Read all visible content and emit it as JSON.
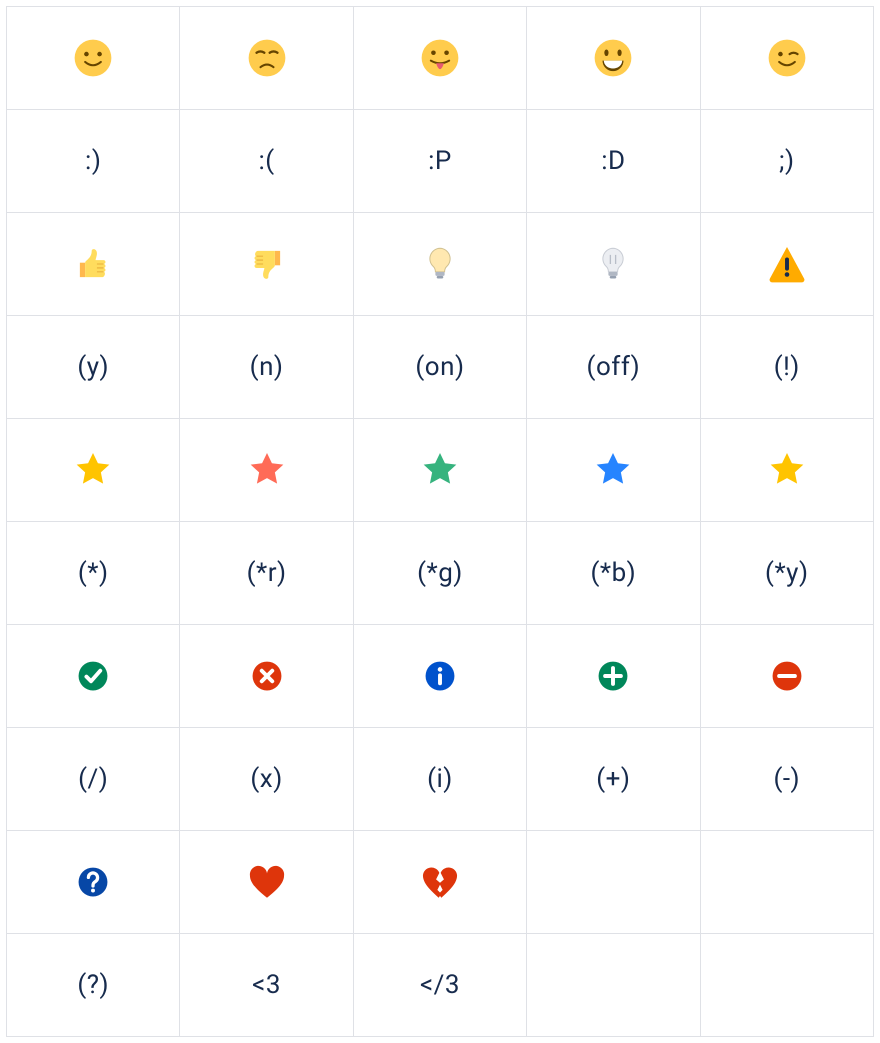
{
  "rows": [
    {
      "icons": [
        {
          "name": "smile-icon",
          "kind": "svg",
          "svg": "smile"
        },
        {
          "name": "frown-icon",
          "kind": "svg",
          "svg": "frown"
        },
        {
          "name": "tongue-icon",
          "kind": "svg",
          "svg": "tongue"
        },
        {
          "name": "grin-icon",
          "kind": "svg",
          "svg": "grin"
        },
        {
          "name": "wink-icon",
          "kind": "svg",
          "svg": "wink"
        }
      ],
      "codes": [
        ":)",
        ":(",
        ":P",
        ":D",
        ";)"
      ]
    },
    {
      "icons": [
        {
          "name": "thumbs-up-icon",
          "kind": "svg",
          "svg": "thumbsup"
        },
        {
          "name": "thumbs-down-icon",
          "kind": "svg",
          "svg": "thumbsdown"
        },
        {
          "name": "bulb-on-icon",
          "kind": "svg",
          "svg": "bulb-on"
        },
        {
          "name": "bulb-off-icon",
          "kind": "svg",
          "svg": "bulb-off"
        },
        {
          "name": "warning-icon",
          "kind": "svg",
          "svg": "warning"
        }
      ],
      "codes": [
        "(y)",
        "(n)",
        "(on)",
        "(off)",
        "(!)"
      ]
    },
    {
      "icons": [
        {
          "name": "star-yellow-icon",
          "kind": "svg",
          "svg": "star",
          "color": "#FFC400"
        },
        {
          "name": "star-red-icon",
          "kind": "svg",
          "svg": "star",
          "color": "#FF6B57"
        },
        {
          "name": "star-green-icon",
          "kind": "svg",
          "svg": "star",
          "color": "#36B37E"
        },
        {
          "name": "star-blue-icon",
          "kind": "svg",
          "svg": "star",
          "color": "#2684FF"
        },
        {
          "name": "star-yellow2-icon",
          "kind": "svg",
          "svg": "star",
          "color": "#FFC400"
        }
      ],
      "codes": [
        "(*)",
        "(*r)",
        "(*g)",
        "(*b)",
        "(*y)"
      ]
    },
    {
      "icons": [
        {
          "name": "check-circle-icon",
          "kind": "svg",
          "svg": "circle-check",
          "color": "#00875A"
        },
        {
          "name": "cross-circle-icon",
          "kind": "svg",
          "svg": "circle-cross",
          "color": "#DE350B"
        },
        {
          "name": "info-circle-icon",
          "kind": "svg",
          "svg": "circle-info",
          "color": "#0052CC"
        },
        {
          "name": "plus-circle-icon",
          "kind": "svg",
          "svg": "circle-plus",
          "color": "#00875A"
        },
        {
          "name": "minus-circle-icon",
          "kind": "svg",
          "svg": "circle-minus",
          "color": "#DE350B"
        }
      ],
      "codes": [
        "(/)",
        "(x)",
        "(i)",
        "(+)",
        "(-)"
      ]
    },
    {
      "icons": [
        {
          "name": "question-circle-icon",
          "kind": "svg",
          "svg": "circle-question",
          "color": "#0747A6"
        },
        {
          "name": "heart-icon",
          "kind": "svg",
          "svg": "heart",
          "color": "#DE350B"
        },
        {
          "name": "broken-heart-icon",
          "kind": "svg",
          "svg": "heart-broken",
          "color": "#DE350B"
        },
        {
          "name": "",
          "kind": "empty"
        },
        {
          "name": "",
          "kind": "empty"
        }
      ],
      "codes": [
        "(?)",
        "<3",
        "</3",
        "",
        ""
      ]
    }
  ]
}
